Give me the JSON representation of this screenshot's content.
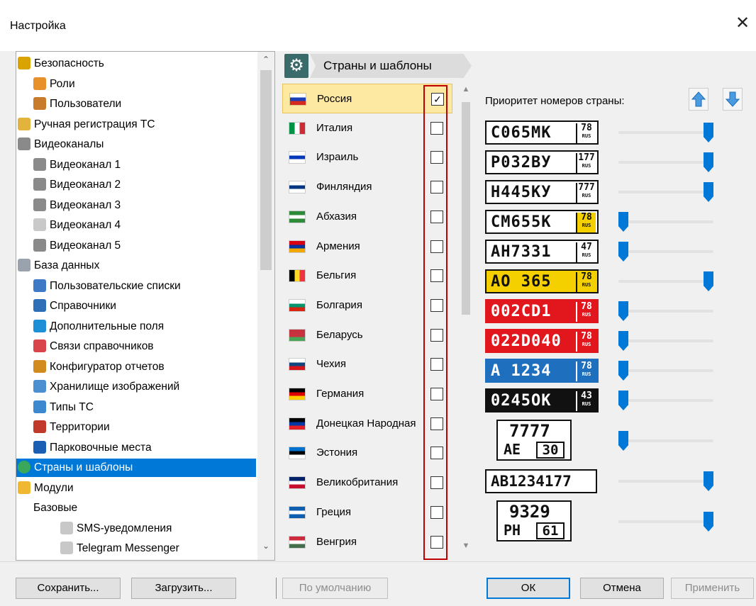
{
  "window": {
    "title": "Настройка",
    "close": "✕"
  },
  "tree": {
    "items": [
      {
        "label": "Безопасность",
        "icon": "lock-icon",
        "indent": 0
      },
      {
        "label": "Роли",
        "icon": "roles-icon",
        "indent": 1
      },
      {
        "label": "Пользователи",
        "icon": "users-icon",
        "indent": 1
      },
      {
        "label": "Ручная регистрация ТС",
        "icon": "pencil-icon",
        "indent": 0
      },
      {
        "label": "Видеоканалы",
        "icon": "camera-icon",
        "indent": 0
      },
      {
        "label": "Видеоканал 1",
        "icon": "camera-icon",
        "indent": 1
      },
      {
        "label": "Видеоканал 2",
        "icon": "camera-icon",
        "indent": 1
      },
      {
        "label": "Видеоканал 3",
        "icon": "camera-icon",
        "indent": 1
      },
      {
        "label": "Видеоканал 4",
        "icon": "camera-disabled-icon",
        "indent": 1
      },
      {
        "label": "Видеоканал 5",
        "icon": "camera-icon",
        "indent": 1
      },
      {
        "label": "База данных",
        "icon": "database-icon",
        "indent": 0
      },
      {
        "label": "Пользовательские списки",
        "icon": "lists-icon",
        "indent": 1
      },
      {
        "label": "Справочники",
        "icon": "books-icon",
        "indent": 1
      },
      {
        "label": "Дополнительные поля",
        "icon": "fields-icon",
        "indent": 1
      },
      {
        "label": "Связи справочников",
        "icon": "link-icon",
        "indent": 1
      },
      {
        "label": "Конфигуратор отчетов",
        "icon": "report-icon",
        "indent": 1
      },
      {
        "label": "Хранилище изображений",
        "icon": "image-storage-icon",
        "indent": 1
      },
      {
        "label": "Типы ТС",
        "icon": "car-icon",
        "indent": 1
      },
      {
        "label": "Территории",
        "icon": "wall-icon",
        "indent": 1
      },
      {
        "label": "Парковочные места",
        "icon": "parking-icon",
        "indent": 1
      },
      {
        "label": "Страны и шаблоны",
        "icon": "globe-icon",
        "indent": 0,
        "selected": true
      },
      {
        "label": "Модули",
        "icon": "puzzle-icon",
        "indent": 0
      },
      {
        "label": "Базовые",
        "icon": "",
        "indent": 1
      },
      {
        "label": "SMS-уведомления",
        "icon": "puzzle-icon",
        "indent": 2
      },
      {
        "label": "Telegram Messenger",
        "icon": "puzzle-icon",
        "indent": 2
      }
    ]
  },
  "panel": {
    "title": "Страны и шаблоны",
    "icon": "gear-icon"
  },
  "countries": [
    {
      "name": "Россия",
      "checked": true,
      "selected": true,
      "flag": [
        "#ffffff",
        "#1c3fb7",
        "#d52b1e"
      ]
    },
    {
      "name": "Италия",
      "checked": false,
      "flag": [
        "#009246",
        "#ffffff",
        "#ce2b37"
      ],
      "vertical": true
    },
    {
      "name": "Израиль",
      "checked": false,
      "flag": [
        "#ffffff",
        "#0038b8",
        "#ffffff"
      ]
    },
    {
      "name": "Финляндия",
      "checked": false,
      "flag": [
        "#ffffff",
        "#003580",
        "#ffffff"
      ]
    },
    {
      "name": "Абхазия",
      "checked": false,
      "flag": [
        "#2e8b3a",
        "#ffffff",
        "#2e8b3a"
      ]
    },
    {
      "name": "Армения",
      "checked": false,
      "flag": [
        "#d90012",
        "#0033a0",
        "#f2a800"
      ]
    },
    {
      "name": "Бельгия",
      "checked": false,
      "flag": [
        "#000000",
        "#fdda24",
        "#ef3340"
      ],
      "vertical": true
    },
    {
      "name": "Болгария",
      "checked": false,
      "flag": [
        "#ffffff",
        "#00966e",
        "#d62612"
      ]
    },
    {
      "name": "Беларусь",
      "checked": false,
      "flag": [
        "#c8313e",
        "#c8313e",
        "#4aa657"
      ]
    },
    {
      "name": "Чехия",
      "checked": false,
      "flag": [
        "#ffffff",
        "#11457e",
        "#d7141a"
      ]
    },
    {
      "name": "Германия",
      "checked": false,
      "flag": [
        "#000000",
        "#dd0000",
        "#ffce00"
      ]
    },
    {
      "name": "Донецкая Народная",
      "checked": false,
      "flag": [
        "#000000",
        "#0039a6",
        "#e31e24"
      ]
    },
    {
      "name": "Эстония",
      "checked": false,
      "flag": [
        "#0072ce",
        "#000000",
        "#ffffff"
      ]
    },
    {
      "name": "Великобритания",
      "checked": false,
      "flag": [
        "#012169",
        "#ffffff",
        "#c8102e"
      ]
    },
    {
      "name": "Греция",
      "checked": false,
      "flag": [
        "#0d5eaf",
        "#ffffff",
        "#0d5eaf"
      ]
    },
    {
      "name": "Венгрия",
      "checked": false,
      "flag": [
        "#cd2a3e",
        "#ffffff",
        "#436f4d"
      ]
    }
  ],
  "priority": {
    "label": "Приоритет номеров страны:",
    "up": "up-arrow-icon",
    "down": "down-arrow-icon"
  },
  "plates": [
    {
      "num": "С065МК",
      "reg": "78",
      "style": "white",
      "level": 1.0
    },
    {
      "num": "Р032ВУ",
      "reg": "177",
      "style": "white",
      "level": 1.0
    },
    {
      "num": "Н445КУ",
      "reg": "777",
      "style": "white",
      "level": 1.0
    },
    {
      "num": "СМ655К",
      "reg": "78",
      "style": "white-yellowreg",
      "level": 0.0
    },
    {
      "num": "АН7331",
      "reg": "47",
      "style": "white",
      "level": 0.0
    },
    {
      "num": "АО 365",
      "reg": "78",
      "style": "yellow",
      "level": 1.0
    },
    {
      "num": "002CD1",
      "reg": "78",
      "style": "red",
      "level": 0.0
    },
    {
      "num": "022D040",
      "reg": "78",
      "style": "red",
      "level": 0.0
    },
    {
      "num": "А 1234",
      "reg": "78",
      "style": "blue",
      "level": 0.0
    },
    {
      "num": "0245ОК",
      "reg": "43",
      "style": "black",
      "level": 0.0
    },
    {
      "num": "7777",
      "num2": "АЕ",
      "reg": "30",
      "style": "square",
      "level": 0.0
    },
    {
      "num": "АВ1234177",
      "reg": "",
      "style": "wide",
      "level": 1.0
    },
    {
      "num": "9329",
      "num2": "РН",
      "reg": "61",
      "style": "square",
      "level": 1.0
    }
  ],
  "buttons": {
    "save": "Сохранить...",
    "load": "Загрузить...",
    "defaults": "По умолчанию",
    "ok": "ОК",
    "cancel": "Отмена",
    "apply": "Применить"
  }
}
